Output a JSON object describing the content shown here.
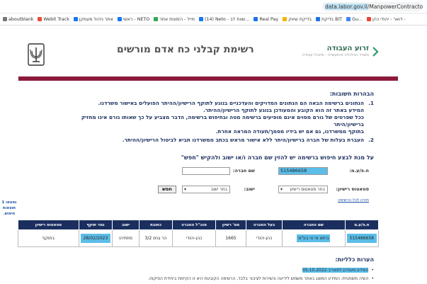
{
  "browser": {
    "url_prefix": "data.labor.gov.il",
    "url_rest": "/ManpowerContractors.aspx",
    "bookmarks": [
      {
        "label": "aboutblank",
        "color": "#777777"
      },
      {
        "label": "Webit Track",
        "color": "#e84c3d"
      },
      {
        "label": "אתר ניהול מעמקן",
        "color": "#1877f2"
      },
      {
        "label": "ראשי - NETO",
        "color": "#1877f2"
      },
      {
        "label": "מייל - הזמנות אתר",
        "color": "#34a853"
      },
      {
        "label": "(14) Neto - שוות לב...",
        "color": "#1877f2"
      },
      {
        "label": "Real Pay",
        "color": "#1a73e8"
      },
      {
        "label": "בדיקת שיווק",
        "color": "#f4b400"
      },
      {
        "label": "בדיקת BIT",
        "color": "#1a73e8"
      },
      {
        "label": "Gu...",
        "color": "#4285f4"
      },
      {
        "label": "דואר - יהודי כהן -",
        "color": "#ea4335"
      }
    ]
  },
  "header": {
    "title": "רשימת קבלני כח אדם מורשים",
    "brand_name": "זרוע העבודה",
    "brand_sub": "משרד הכלכלה והתעשייה · מינהל עבודה"
  },
  "notes": {
    "heading": "הבהרות חשובות:",
    "items": [
      {
        "num": "1.",
        "lines": [
          "הנתונים ברשימה הבאה הם הנתונים המדויקים והעדכניים בנוגע לתוקף הרישיון/ההיתר הפועלים באישור משרדנו.",
          "המידע באתר זה הוא הקובע והמעודכן בנוגע לתוקף הרישיון/ההיתר.",
          "ככל שפרטים של גורם מסוים אינם מופיעים ברשימה מטה ובחיפוש ברשימה, הדבר מצביע על כך שאותו גורם אינו מחזיק ברישיון/היתר",
          "בתוקף ממשרדנו, גם אם יש בידיו מסמך/תעודה המראה אחרת."
        ]
      },
      {
        "num": "2.",
        "lines": [
          "העברת בעלות של חברה ברישיון/היתר ללא אישור מראש בכתב ממשרדנו תביא לביטול הרישיון/ההיתר."
        ]
      }
    ]
  },
  "search": {
    "heading": "על מנת לבצע חיפוש ברשימה יש להזין שם חברה ו/או ישוב ולהקיש \"חפש\"",
    "company_id_label": "ח.פ/ע.מ:",
    "company_id_value": "515486658",
    "company_name_label": "שם חברה:",
    "company_name_value": "",
    "status_label": "סטאטוס רישיון:",
    "status_value": "בחר סטאטוס רישיון",
    "city_label": "ישוב:",
    "city_value": "בחר ישוב",
    "search_button": "חפש",
    "back_link": "חזרה לכל הרשימה"
  },
  "results_count": "נמצאו 1 תוצאות חיפוש.",
  "table": {
    "headers": [
      "ח.פ/ע.מ",
      "שם החברה",
      "בעל החברה",
      "מס' רשיון",
      "מנכ\"ל החברה",
      "כתובת",
      "ישוב",
      "גמר תוקף",
      "סטאטוס רישיון"
    ],
    "rows": [
      [
        "515486658",
        "ביתא אי טי בע\"מ",
        "כהן-יהודי",
        "1665",
        "כהן-יהודי",
        "הר גנים 3/2",
        "מתתיהו",
        "28/02/2023",
        "בתוקף"
      ]
    ]
  },
  "general": {
    "heading": "הערות כלליות:",
    "item1": "המידע מעודכן לתאריך 05.10.2022",
    "item2": "השיה משפטית: המידע המוצג באתר משמש לידיעה וכשירות לציבור בלבד, הרשימה הקובעת היא זו הקיימת ביחידת הפיקוח."
  }
}
